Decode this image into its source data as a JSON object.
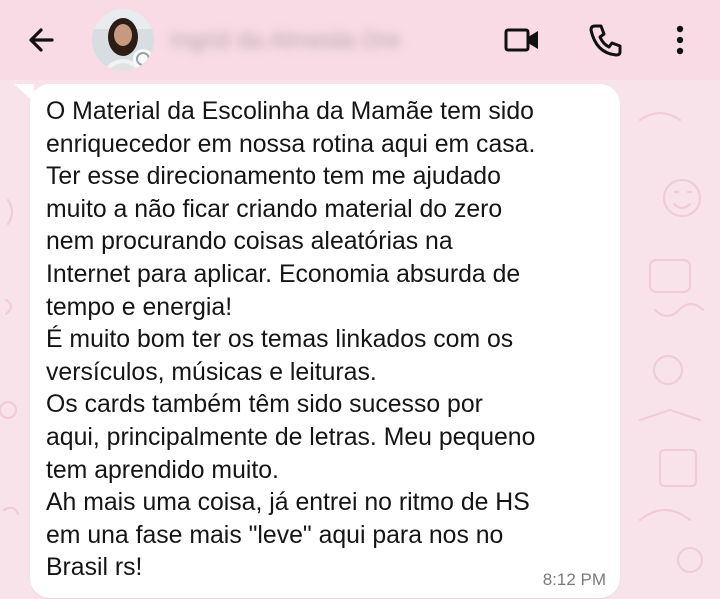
{
  "header": {
    "contact_name": "Ingrid da Almeida Dre",
    "icons": {
      "back": "back-arrow-icon",
      "video": "video-call-icon",
      "call": "phone-call-icon",
      "menu": "more-options-icon"
    }
  },
  "message": {
    "text": "O Material da Escolinha da Mamãe tem sido\nenriquecedor em nossa rotina aqui em casa.\nTer esse direcionamento tem me ajudado\nmuito a não ficar criando material do zero\nnem procurando coisas aleatórias na\nInternet para aplicar. Economia absurda de\ntempo e energia!\nÉ muito bom ter os temas linkados com os\nversículos, músicas e leituras.\nOs cards também têm sido sucesso por\naqui, principalmente de letras. Meu pequeno\ntem aprendido muito.\nAh mais uma coisa, já entrei no ritmo de HS\nem una fase mais \"leve\" aqui para nos no\nBrasil rs!",
    "time": "8:12 PM"
  },
  "colors": {
    "header_bg": "#f9dbe6",
    "chat_bg": "#f9e3eb",
    "bubble_bg": "#ffffff",
    "text": "#151515",
    "time": "#7b7b7b"
  }
}
